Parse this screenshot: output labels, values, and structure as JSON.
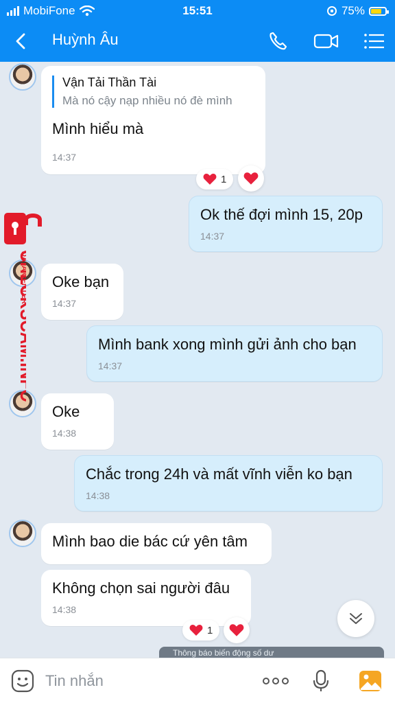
{
  "status": {
    "carrier": "MobiFone",
    "time": "15:51",
    "battery": "75%"
  },
  "header": {
    "contact_name": "Huỳnh Âu"
  },
  "messages": [
    {
      "quote_name": "Vận Tải Thần Tài",
      "quote_text": "Mà nó cậy nạp nhiều nó đè mình",
      "text": "Mình hiểu mà",
      "time": "14:37",
      "reaction_count": "1"
    },
    {
      "text": "Ok thế đợi mình 15, 20p",
      "time": "14:37"
    },
    {
      "text": "Oke bạn",
      "time": "14:37"
    },
    {
      "text": "Mình bank xong mình gửi ảnh cho bạn",
      "time": "14:37"
    },
    {
      "text": "Oke",
      "time": "14:38"
    },
    {
      "text": "Chắc trong 24h và mất vĩnh viễn ko bạn",
      "time": "14:38"
    },
    {
      "text": "Mình bao die bác cứ yên tâm"
    },
    {
      "text": "Không chọn sai người đâu",
      "time": "14:38",
      "reaction_count": "1"
    }
  ],
  "preview_text": "Thông báo biến động số dư",
  "watermark": {
    "brand": "CHECKSCAM.INFO",
    "sub": "DATA CENTER"
  },
  "composer": {
    "placeholder": "Tin nhắn"
  },
  "colors": {
    "header": "#0c8cf5",
    "outgoing": "#d6eefc",
    "incoming": "#ffffff",
    "background": "#e2e9f1",
    "heart": "#e8213d",
    "watermark": "#e21b2a"
  }
}
